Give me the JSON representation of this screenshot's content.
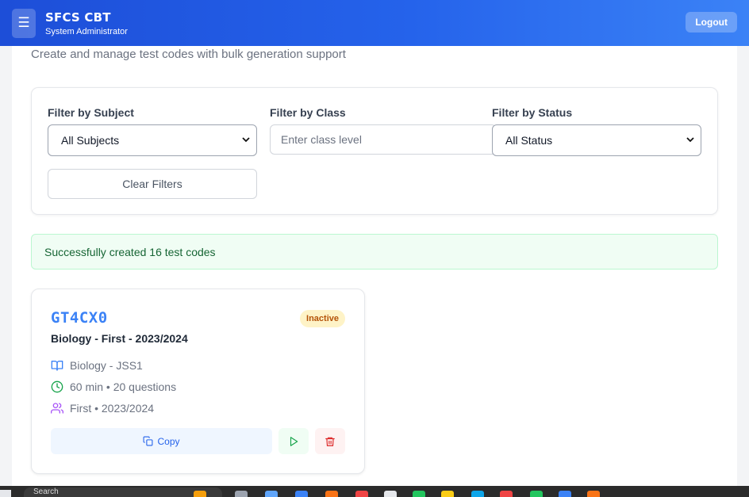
{
  "header": {
    "title": "SFCS CBT",
    "subtitle": "System Administrator",
    "menu_icon": "☰",
    "logout_label": "Logout"
  },
  "page": {
    "subtitle": "Create and manage test codes with bulk generation support"
  },
  "filters": {
    "subject_label": "Filter by Subject",
    "subject_value": "All Subjects",
    "class_label": "Filter by Class",
    "class_placeholder": "Enter class level",
    "status_label": "Filter by Status",
    "status_value": "All Status",
    "clear_label": "Clear Filters"
  },
  "alert": {
    "message": "Successfully created 16 test codes"
  },
  "cards": [
    {
      "code": "GT4CX0",
      "status": "Inactive",
      "title": "Biology - First - 2023/2024",
      "subject_class": "Biology - JSS1",
      "duration_questions": "60 min • 20 questions",
      "term_session": "First • 2023/2024",
      "copy_label": "Copy"
    }
  ],
  "taskbar": {
    "search_text": "Search"
  },
  "colors": {
    "accent": "#2563eb",
    "code": "#3b82f6",
    "success_bg": "#f0fdf4",
    "inactive_badge": "#fef3c7"
  }
}
